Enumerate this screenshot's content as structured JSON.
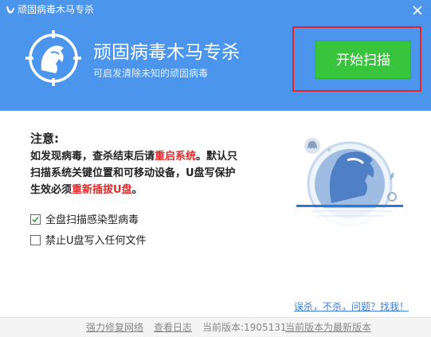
{
  "window": {
    "title": "顽固病毒木马专杀"
  },
  "hero": {
    "title": "顽固病毒木马专杀",
    "subtitle": "可启发清除未知的顽固病毒",
    "start_button": "开始扫描"
  },
  "notice": {
    "heading": "注意:",
    "line1_a": "如发现病毒，查杀结束后请",
    "line1_red": "重启系统",
    "line1_b": "。默认只",
    "line2": "扫描系统关键位置和可移动设备，U盘写保护",
    "line3_a": "生效必须",
    "line3_red": "重新插拔U盘",
    "line3_b": "。"
  },
  "options": [
    {
      "label": "全盘扫描感染型病毒",
      "checked": true
    },
    {
      "label": "禁止U盘写入任何文件",
      "checked": false
    }
  ],
  "help_link": "误杀，不杀，问题？找我！",
  "footer": {
    "repair": "强力修复网络",
    "log": "查看日志",
    "version": "当前版本:1905131",
    "latest": "当前版本为最新版本"
  },
  "colors": {
    "header": "#4b96ec",
    "start_button": "#38c43c",
    "highlight": "#e6212a",
    "warning": "#e22b2b"
  }
}
